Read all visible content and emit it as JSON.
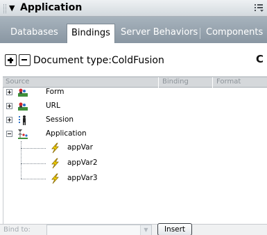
{
  "panel": {
    "title": "Application",
    "collapse_icon": "triangle-down-icon",
    "options_icon": "panel-options-icon"
  },
  "tabs": [
    {
      "label": "Databases",
      "active": false
    },
    {
      "label": "Bindings",
      "active": true
    },
    {
      "label": "Server Behaviors",
      "active": false
    },
    {
      "label": "Components",
      "active": false
    }
  ],
  "toolbar": {
    "add_icon": "plus-icon",
    "remove_icon": "minus-icon",
    "document_type": "Document type:ColdFusion",
    "refresh_icon": "refresh-icon"
  },
  "columns": {
    "source": "Source",
    "binding": "Binding",
    "format": "Format"
  },
  "tree": {
    "nodes": [
      {
        "label": "Form",
        "expanded": false,
        "icon": "form-variables-icon"
      },
      {
        "label": "URL",
        "expanded": false,
        "icon": "url-variables-icon"
      },
      {
        "label": "Session",
        "expanded": false,
        "icon": "session-variables-icon"
      },
      {
        "label": "Application",
        "expanded": true,
        "icon": "application-variables-icon",
        "children": [
          {
            "label": "appVar",
            "icon": "variable-bolt-icon"
          },
          {
            "label": "appVar2",
            "icon": "variable-bolt-icon"
          },
          {
            "label": "appVar3",
            "icon": "variable-bolt-icon"
          }
        ]
      }
    ]
  },
  "bottom": {
    "bind_to_label": "Bind to:",
    "bind_to_value": "",
    "insert_label": "Insert"
  },
  "colors": {
    "tab_strip": "#97a4b0",
    "header_gradient_top": "#eef1f3",
    "column_header": "#d5d8db",
    "bolt_yellow": "#f2d000"
  }
}
